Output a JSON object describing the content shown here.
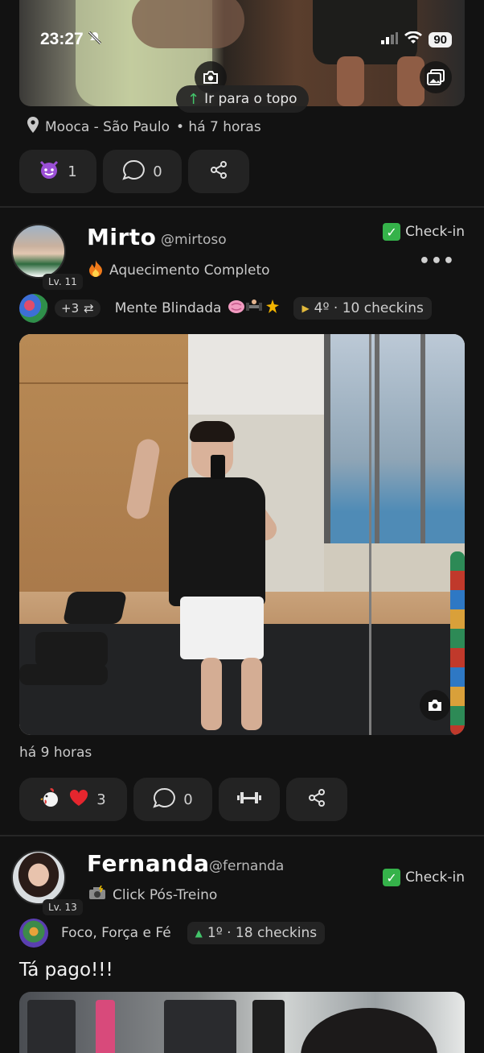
{
  "status_bar": {
    "time": "23:27",
    "battery": "90"
  },
  "scroll_top": {
    "label": "Ir para o topo"
  },
  "prev_post": {
    "location": "Mooca - São Paulo",
    "time_ago": "• há 7 horas",
    "reaction_count": "1",
    "comment_count": "0"
  },
  "post1": {
    "name": "Mirto",
    "handle": "@mirtoso",
    "level": "Lv. 11",
    "checkin_label": "Check-in",
    "subtitle": "Aquecimento Completo",
    "group_extra": "+3",
    "group_name": "Mente Blindada",
    "rank": "4º · 10 checkins",
    "time_ago": "há 9 horas",
    "reaction_count": "3",
    "comment_count": "0"
  },
  "post2": {
    "name": "Fernanda",
    "handle": "@fernanda",
    "level": "Lv. 13",
    "checkin_label": "Check-in",
    "subtitle": "Click Pós-Treino",
    "group_name": "Foco, Força e Fé",
    "rank": "1º · 18 checkins",
    "caption": "Tá pago!!!"
  },
  "colors": {
    "background": "#121212",
    "pill": "#232323",
    "check_green": "#35b24a",
    "rank_up": "#43c46a",
    "rank_neutral": "#e2b93b"
  }
}
